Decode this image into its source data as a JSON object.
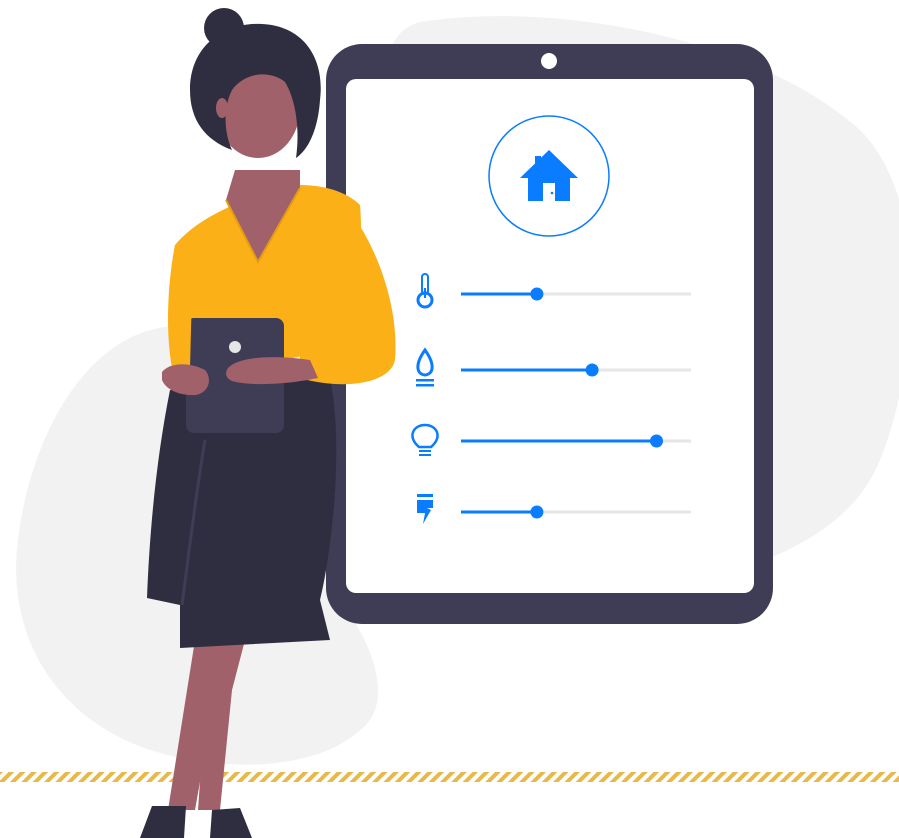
{
  "colors": {
    "accent": "#0a7cff",
    "device_frame": "#3f3d56",
    "shirt": "#fbb017",
    "skin": "#a0616a",
    "hair": "#2f2e41",
    "skirt": "#2f2e41",
    "blob": "#f2f2f2",
    "slider_track": "#e6e6e6",
    "floor_stripe": "#e6b94a"
  },
  "device": {
    "home_icon": "house-icon",
    "controls": [
      {
        "id": "temperature",
        "icon": "thermometer-icon",
        "level": 0.33
      },
      {
        "id": "water",
        "icon": "water-drop-icon",
        "level": 0.57
      },
      {
        "id": "light",
        "icon": "light-bulb-icon",
        "level": 0.85
      },
      {
        "id": "power",
        "icon": "power-outlet-icon",
        "level": 0.33
      }
    ]
  }
}
